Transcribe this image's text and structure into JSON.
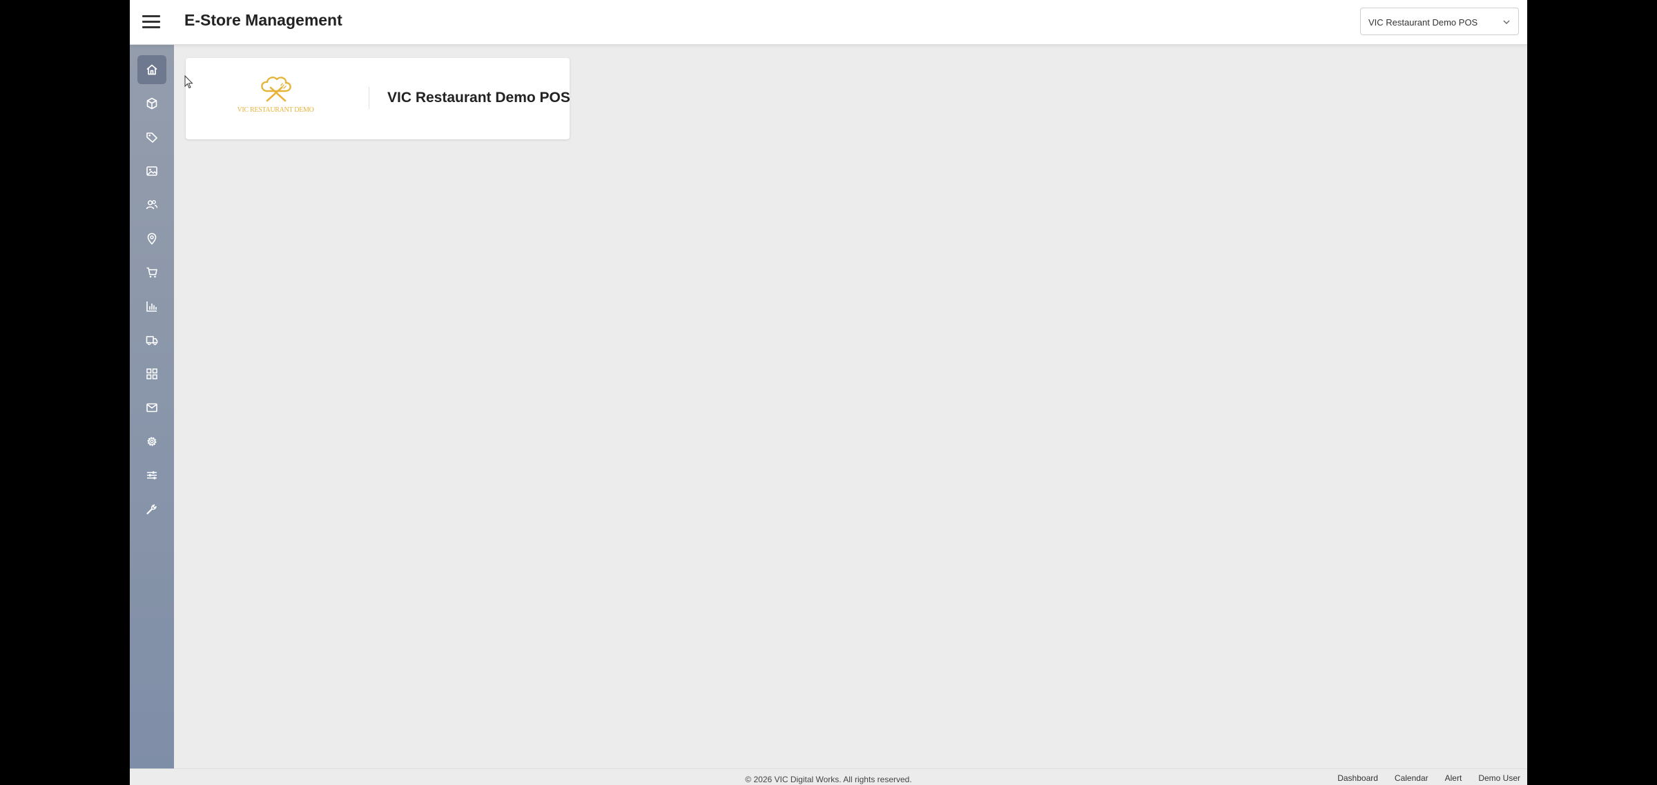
{
  "header": {
    "menu_icon": "hamburger-menu-icon",
    "title": "E-Store Management",
    "store_selector": {
      "selected": "VIC Restaurant Demo POS",
      "icon": "chevron-down-icon"
    }
  },
  "sidebar": {
    "items": [
      {
        "key": "home",
        "icon": "home-icon",
        "active": true
      },
      {
        "key": "products",
        "icon": "cube-icon",
        "active": false
      },
      {
        "key": "tags",
        "icon": "tag-icon",
        "active": false
      },
      {
        "key": "media",
        "icon": "image-icon",
        "active": false
      },
      {
        "key": "customers",
        "icon": "users-icon",
        "active": false
      },
      {
        "key": "locations",
        "icon": "map-pin-icon",
        "active": false
      },
      {
        "key": "orders",
        "icon": "cart-icon",
        "active": false
      },
      {
        "key": "reports",
        "icon": "bar-chart-icon",
        "active": false
      },
      {
        "key": "delivery",
        "icon": "truck-icon",
        "active": false
      },
      {
        "key": "widgets",
        "icon": "grid-icon",
        "active": false
      },
      {
        "key": "messages",
        "icon": "mail-icon",
        "active": false
      },
      {
        "key": "settings",
        "icon": "gear-icon",
        "active": false
      },
      {
        "key": "preferences",
        "icon": "sliders-icon",
        "active": false
      },
      {
        "key": "tools",
        "icon": "wrench-icon",
        "active": false
      }
    ]
  },
  "main": {
    "store_card": {
      "logo_icon": "chef-hat-logo-icon",
      "logo_text": "VIC RESTAURANT DEMO",
      "name": "VIC Restaurant Demo POS",
      "colors": {
        "logo": "#e6b43a"
      }
    }
  },
  "footer": {
    "copyright": "© 2026 VIC Digital Works. All rights reserved.",
    "links": [
      "Dashboard",
      "Calendar",
      "Alert",
      "Demo User"
    ]
  },
  "colors": {
    "sidebar_top": "#949dac",
    "sidebar_bottom": "#7f8ea7",
    "sidebar_active": "#6e7990",
    "content_bg": "#ececec",
    "logo_gold": "#e6b43a"
  }
}
